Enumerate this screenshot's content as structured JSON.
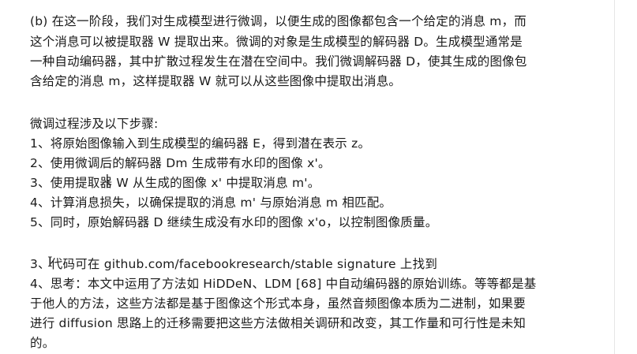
{
  "paragraph_b": [
    "(b) 在这一阶段，我们对生成模型进行微调，以便生成的图像都包含一个给定的消息 m，而",
    "这个消息可以被提取器 W 提取出来。微调的对象是生成模型的解码器 D。生成模型通常是",
    "一种自动编码器，其中扩散过程发生在潜在空间中。我们微调解码器 D，使其生成的图像包",
    "含给定的消息 m，这样提取器 W 就可以从这些图像中提取出消息。"
  ],
  "steps_intro": "微调过程涉及以下步骤:",
  "steps": [
    "1、将原始图像输入到生成模型的编码器 E，得到潜在表示 z。",
    "2、使用微调后的解码器 Dm 生成带有水印的图像 x'。",
    "3、使用提取器 W 从生成的图像 x'  中提取消息 m'。",
    "4、计算消息损失，以确保提取的消息 m'  与原始消息 m  相匹配。",
    "5、同时，原始解码器 D 继续生成没有水印的图像 x'o，以控制图像质量。"
  ],
  "note3": "3、代码可在 github.com/facebookresearch/stable signature 上找到",
  "note4": [
    "4、思考：本文中运用了方法如 HiDDeN、LDM [68] 中自动编码器的原始训练。等等都是基",
    "于他人的方法，这些方法都是基于图像这个形式本身，虽然音频图像本质为二进制，如果要",
    "进行 diffusion 思路上的迁移需要把这些方法做相关调研和改变，其工作量和可行性是未知",
    "的。"
  ]
}
